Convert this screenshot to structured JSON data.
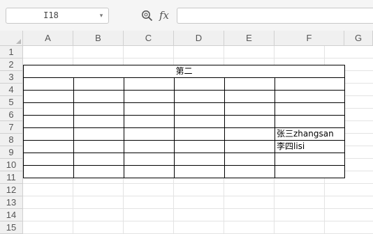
{
  "formula_bar": {
    "cell_reference": "I18",
    "fx_label": "fx",
    "formula_value": ""
  },
  "columns": [
    "A",
    "B",
    "C",
    "D",
    "E",
    "F",
    "G"
  ],
  "rows": [
    "1",
    "2",
    "3",
    "4",
    "5",
    "6",
    "7",
    "8",
    "9",
    "10",
    "11",
    "12",
    "13",
    "14",
    "15"
  ],
  "sheet": {
    "merged_title": "第二",
    "f7": "张三zhangsan",
    "f8": "李四lisi"
  },
  "colors": {
    "header_bg": "#f0f0f0",
    "gridline": "#e3e3e3",
    "cell_border": "#000000"
  }
}
